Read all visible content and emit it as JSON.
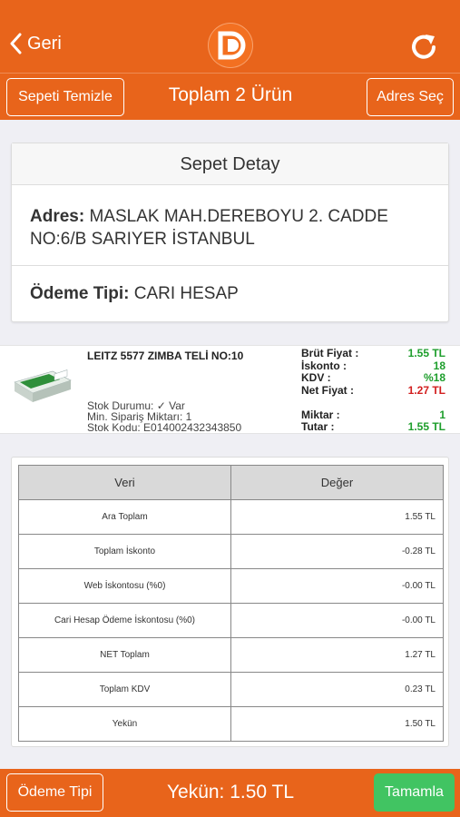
{
  "header": {
    "back_label": "Geri"
  },
  "toolbar": {
    "clear_cart_label": "Sepeti Temizle",
    "title": "Toplam 2 Ürün",
    "select_address_label": "Adres Seç"
  },
  "cart_detail": {
    "title": "Sepet Detay",
    "address_label": "Adres:",
    "address_value": "MASLAK MAH.DEREBOYU 2. CADDE NO:6/B SARIYER İSTANBUL",
    "payment_label": "Ödeme Tipi:",
    "payment_value": "CARI HESAP"
  },
  "product": {
    "name": "LEITZ 5577 ZIMBA TELİ NO:10",
    "stock_status": "Stok Durumu: ✓ Var",
    "min_order": "Min. Sipariş Miktarı: 1",
    "stock_code": "Stok Kodu: E014002432343850",
    "labels": {
      "gross_price": "Brüt Fiyat :",
      "discount": "İskonto :",
      "kdv": "KDV :",
      "net_price": "Net Fiyat :",
      "quantity": "Miktar :",
      "amount": "Tutar :"
    },
    "values": {
      "gross_price": "1.55 TL",
      "discount": "18",
      "kdv": "%18",
      "net_price": "1.27 TL",
      "quantity": "1",
      "amount": "1.55 TL"
    }
  },
  "summary_table": {
    "headers": [
      "Veri",
      "Değer"
    ],
    "rows": [
      {
        "label": "Ara Toplam",
        "value": "1.55 TL"
      },
      {
        "label": "Toplam İskonto",
        "value": "-0.28 TL"
      },
      {
        "label": "Web İskontosu (%0)",
        "value": "-0.00 TL"
      },
      {
        "label": "Cari Hesap Ödeme İskontosu (%0)",
        "value": "-0.00 TL"
      },
      {
        "label": "NET Toplam",
        "value": "1.27 TL"
      },
      {
        "label": "Toplam KDV",
        "value": "0.23 TL"
      },
      {
        "label": "Yekün",
        "value": "1.50 TL"
      }
    ]
  },
  "footer": {
    "payment_type_label": "Ödeme Tipi",
    "total_text": "Yekün: 1.50 TL",
    "complete_label": "Tamamla"
  },
  "colors": {
    "brand_orange": "#e8641b",
    "success_green": "#41c462",
    "price_green": "#1e9e2c",
    "price_red": "#d21f1f"
  },
  "icons": [
    "chevron-left-icon",
    "brand-logo",
    "refresh-icon",
    "checkmark-icon"
  ]
}
